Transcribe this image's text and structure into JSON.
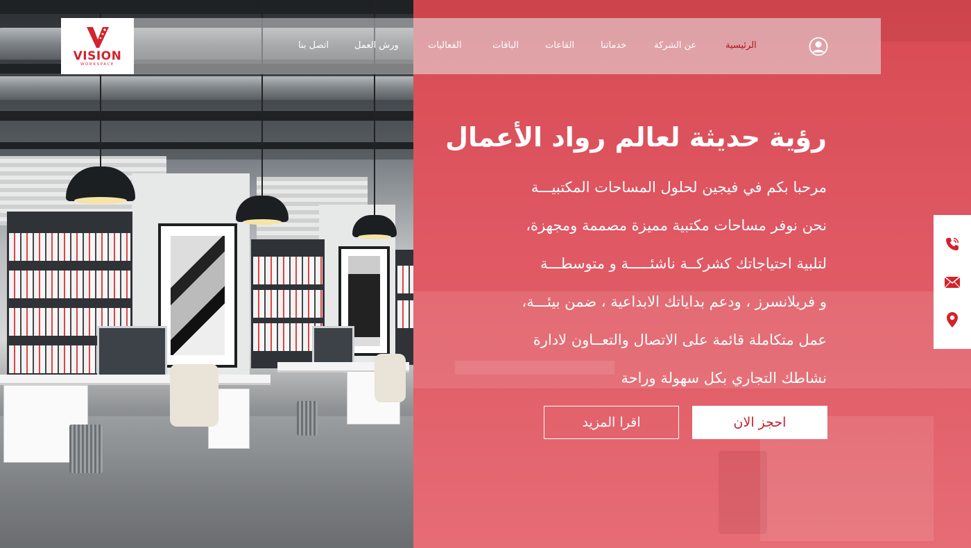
{
  "brand": {
    "name": "VISION",
    "tagline": "WORKSPACE",
    "accent_color": "#d3232d"
  },
  "nav": {
    "items": [
      {
        "label": "الرئيسية",
        "active": true
      },
      {
        "label": "عن الشركة",
        "active": false
      },
      {
        "label": "خدماتنا",
        "active": false
      },
      {
        "label": "القاعات",
        "active": false
      },
      {
        "label": "الباقات",
        "active": false
      },
      {
        "label": "الفعاليات",
        "active": false
      },
      {
        "label": "ورش العمل",
        "active": false
      },
      {
        "label": "اتصل بنا",
        "active": false
      }
    ],
    "account_icon": "user-circle-icon"
  },
  "hero": {
    "title": "رؤية حديثة لعالم رواد الأعمال",
    "lines": [
      "مرحبا بكم في فيجين لحلول المساحات المكتبيـــة",
      "نحن نوفر مساحات مكتبية مميزة مصممة ومجهزة،",
      "لتلبية  احتياجاتك كشركــة ناشئـــــة و متوسطـــة",
      "و فريلانسرز ، ودعم بداياتك الابداعية ، ضمن بيئـــة،",
      "عمل متكاملة قائمة على الاتصال والتعــاون لادارة",
      "نشاطك التجاري بكل سهولة وراحة"
    ],
    "primary_button": "احجز الان",
    "secondary_button": "اقرا المزيد"
  },
  "contact_tab": {
    "icons": [
      "phone-icon",
      "mail-icon",
      "location-pin-icon"
    ]
  },
  "colors": {
    "panel_red": "#de5560",
    "active_nav": "#b0141f",
    "white": "#ffffff"
  }
}
